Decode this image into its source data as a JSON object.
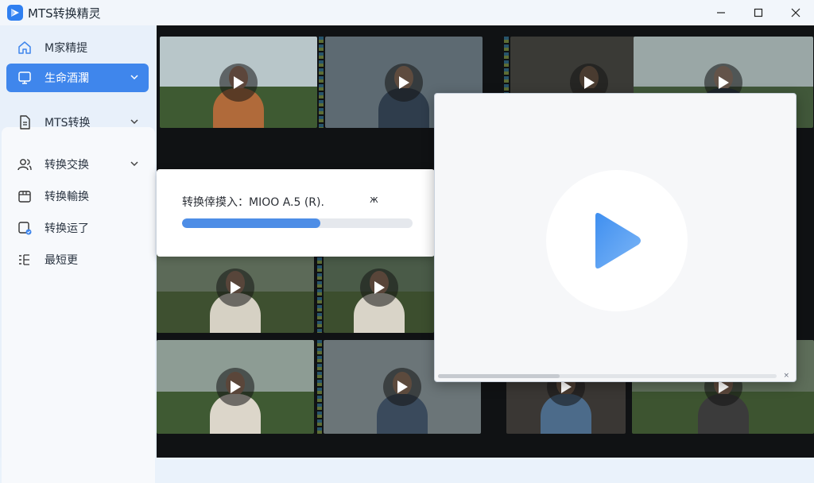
{
  "app": {
    "title": "MTS转换精灵",
    "controls": {
      "minimize": "minimize-icon",
      "maximize": "maximize-icon",
      "close": "close-icon"
    }
  },
  "sidebar": {
    "items": [
      {
        "label": "M家精提",
        "icon": "home-icon",
        "active": false,
        "has_chevron": false
      },
      {
        "label": "生命酒瀾",
        "icon": "monitor-icon",
        "active": true,
        "has_chevron": true
      },
      {
        "label": "MTS转换",
        "icon": "document-icon",
        "active": false,
        "has_chevron": true
      },
      {
        "label": "转换交换",
        "icon": "users-icon",
        "active": false,
        "has_chevron": true
      },
      {
        "label": "转换輸换",
        "icon": "folder-icon",
        "active": false,
        "has_chevron": false
      },
      {
        "label": "转换运了",
        "icon": "edit-badge-icon",
        "active": false,
        "has_chevron": false
      },
      {
        "label": "最短更",
        "icon": "list-icon",
        "active": false,
        "has_chevron": false
      }
    ]
  },
  "progress": {
    "label": "转换倖摸入：MIOO A.5 (R).",
    "suffix": "ж",
    "fraction": 0.6
  },
  "player": {
    "scroll_fraction": 0.36,
    "close_glyph": "×"
  },
  "colors": {
    "accent": "#3f86ec",
    "progress": "#4d8de6",
    "play_gradient_start": "#3f8ff0",
    "play_gradient_end": "#7db6f6"
  }
}
